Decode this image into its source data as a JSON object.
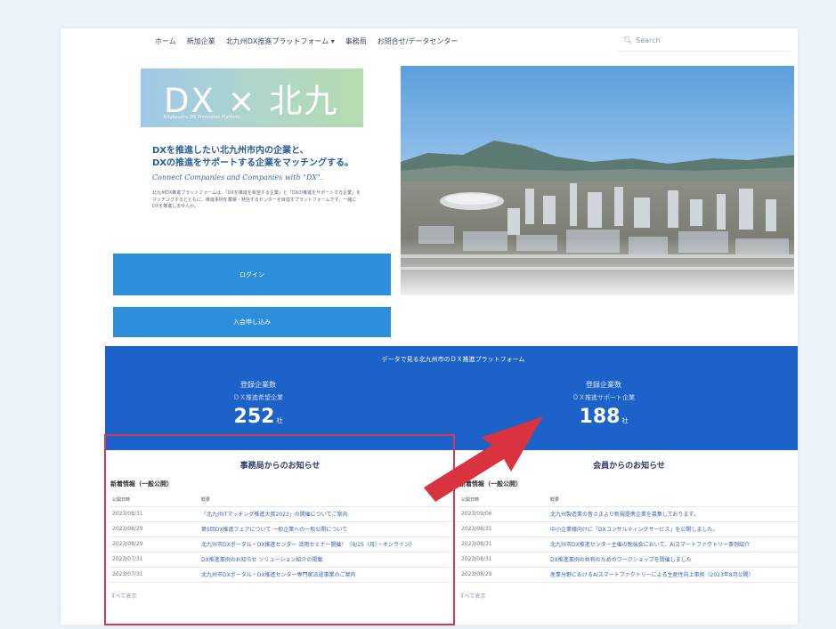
{
  "nav": {
    "items": [
      "ホーム",
      "新加企業",
      "北九州DX推進プラットフォーム ▾",
      "事務局",
      "お問合せ/データセンター"
    ],
    "search_placeholder": "Search"
  },
  "logo": {
    "title": "DX × 北九州",
    "subtitle": "Kitakyushu DX Promotion Platform"
  },
  "intro": {
    "headline_1": "DXを推進したい北九州市内の企業と、",
    "headline_2": "DXの推進をサポートする企業をマッチングする。",
    "tagline": "Connect Companies and Companies with \"DX\".",
    "description": "北九州DX推進プラットフォームは、「DXを推進を希望する企業」と「DXの推進をサポートする企業」をマッチングするとともに、推進事例を蓄積・発信するセンターを目指すプラットフォームです。一緒にDXを推進しませんか。"
  },
  "buttons": {
    "login": "ログイン",
    "join": "入会申し込み"
  },
  "stats": {
    "title": "データで見る北九州市のＤＸ推進プラットフォーム",
    "left": {
      "label": "登録企業数",
      "sub": "ＤＸ推進希望企業",
      "value": "252",
      "unit": "社"
    },
    "right": {
      "label": "登録企業数",
      "sub": "ＤＸ推進サポート企業",
      "value": "188",
      "unit": "社"
    }
  },
  "news_left": {
    "heading": "事務局からのお知らせ",
    "subheading": "新着情報（一般公開）",
    "col_date": "公開日時",
    "col_title": "概要",
    "rows": [
      {
        "date": "2023/08/31",
        "title": "「北九州ITマッチング推進大賞2023」の開催についてご案内"
      },
      {
        "date": "2023/08/29",
        "title": "第5回DX推進フェアについて 一般企業への一般公開について"
      },
      {
        "date": "2023/08/29",
        "title": "北九州市DXポータル・DX推進センター 活用セミナー開催！（9/25（月）・オンライン）"
      },
      {
        "date": "2023/07/31",
        "title": "DX推進事例のお知らせ ソリューション紹介の掲載"
      },
      {
        "date": "2023/07/31",
        "title": "北九州市DXポータル・DX推進センター専門家派遣事業のご案内"
      }
    ],
    "more": "すべて表示"
  },
  "news_right": {
    "heading": "会員からのお知らせ",
    "subheading": "新着情報（一般公開）",
    "col_date": "公開日時",
    "col_title": "概要",
    "rows": [
      {
        "date": "2023/09/06",
        "title": "北九州製造業の皆さまより新規提携企業を募集しております。"
      },
      {
        "date": "2023/08/31",
        "title": "中小企業様向けに「DXコンサルティングサービス」を公開しました。"
      },
      {
        "date": "2023/08/31",
        "title": "北九州市DX推進センター主催の勉強会において、AIスマートファクトリー事例紹介"
      },
      {
        "date": "2023/08/31",
        "title": "DX推進事例の共有のためのワークショップを開催しました"
      },
      {
        "date": "2023/08/29",
        "title": "産業分野におけるAIスマートファクトリーによる生産性向上事例（2023年8月公開）"
      }
    ],
    "more": "すべて表示"
  },
  "colors": {
    "accent_blue": "#2d8fdc",
    "stats_band": "#1d62c8",
    "highlight_red": "#d43a55",
    "arrow_red": "#d9333f"
  }
}
